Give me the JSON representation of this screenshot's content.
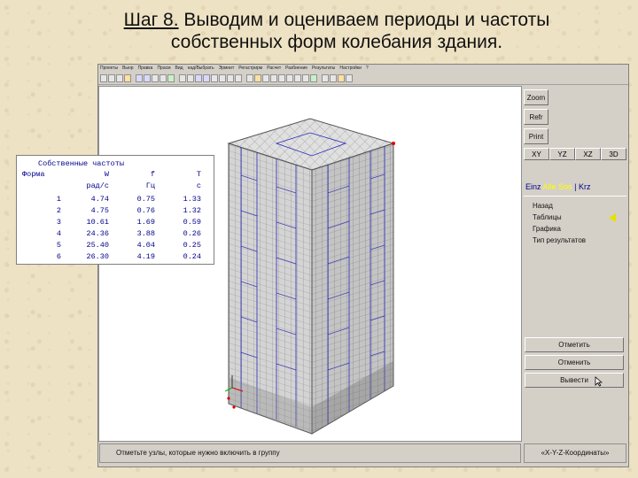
{
  "slide": {
    "title_step": "Шаг 8.",
    "title_rest": " Выводим и оцениваем периоды и частоты",
    "title_line2": "собственных форм колебания здания."
  },
  "menu": {
    "items": [
      "Проекты",
      "Вьюр",
      "Правка",
      "Прасм",
      "Вид",
      "над/Выбрать",
      "Эрмнит",
      "Регастрирм",
      "Расчет",
      "Разбиение",
      "Результаты",
      "Настройки",
      "?"
    ]
  },
  "side_panel": {
    "zoom": "Zoom",
    "refr": "Refr",
    "print": "Print",
    "view_tabs": [
      "XY",
      "YZ",
      "XZ",
      "3D"
    ],
    "mode_row": {
      "a": "Einz",
      "b": "Alle",
      "c": "Sos",
      "sep": "|",
      "d": "Krz"
    },
    "nav_items": [
      "Назад",
      "Таблицы",
      "Графика",
      "Тип результатов"
    ],
    "btn_mark": "Отметить",
    "btn_cancel": "Отменить",
    "btn_output": "Вывести",
    "status_right": "«X-Y-Z-Координаты»"
  },
  "status_left": "Отметьте узлы, которые нужно включить в группу",
  "freq_table": {
    "title": "Собственные частоты",
    "headers": [
      "Форма",
      "W",
      "f",
      "T"
    ],
    "units": [
      "",
      "рад/с",
      "Гц",
      "с"
    ],
    "rows": [
      [
        "1",
        "4.74",
        "0.75",
        "1.33"
      ],
      [
        "2",
        "4.75",
        "0.76",
        "1.32"
      ],
      [
        "3",
        "10.61",
        "1.69",
        "0.59"
      ],
      [
        "4",
        "24.36",
        "3.88",
        "0.26"
      ],
      [
        "5",
        "25.40",
        "4.04",
        "0.25"
      ],
      [
        "6",
        "26.30",
        "4.19",
        "0.24"
      ]
    ]
  },
  "colors": {
    "slide_bg": "#eee2c4",
    "window_bg": "#d4d0c8",
    "table_text": "#00008b",
    "mesh_blue": "#2a2ab8",
    "mesh_face_left": "#d2d2d2",
    "mesh_face_right": "#c0c0c0",
    "active_mode": "#ffff00",
    "arrow": "#e8e000"
  },
  "icons": {
    "arrow_indicator": "triangle-left-icon",
    "cursor": "mouse-pointer-icon"
  }
}
